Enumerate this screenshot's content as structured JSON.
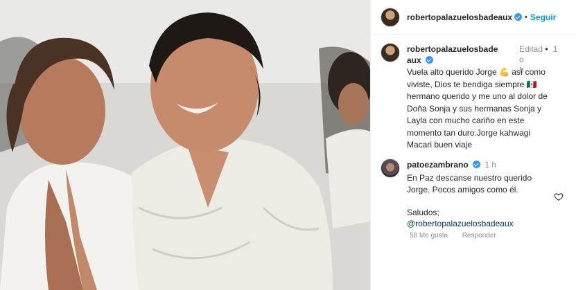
{
  "header": {
    "username": "robertopalazuelosbadeaux",
    "follow_label": "Seguir",
    "separator": "•"
  },
  "comments": [
    {
      "username_line1": "robertopalazuelosbade",
      "username_line2": "aux",
      "edited_line1": "Editad",
      "edited_line2": "o",
      "time": "1 h",
      "text_lines": [
        "Vuela alto querido Jorge 💪 así como",
        "viviste,  Dios te bendiga siempre 🇲🇽",
        "hermano querido y me uno al dolor de",
        "Doña Sonja  y sus hermanas  Sonja y",
        "Layla  con mucho cariño en este",
        "momento tan duro.Jorge kahwagi",
        "Macari  buen viaje"
      ]
    },
    {
      "username": "patoezambrano",
      "time": "1 h",
      "text_line1": "En Paz descanse nuestro querido",
      "text_line2": "Jorge. Pocos amigos como él.",
      "text_line3": "Saludos;",
      "mention": "@robertopalazuelosbadeaux",
      "likes": "58 Me gusta",
      "reply": "Responder"
    }
  ],
  "icons": {
    "verified": "verified-badge-icon",
    "heart": "heart-icon"
  },
  "colors": {
    "accent": "#0095f6",
    "verified": "#3897f0",
    "muted": "#8e8e8e",
    "mention": "#00376b"
  }
}
